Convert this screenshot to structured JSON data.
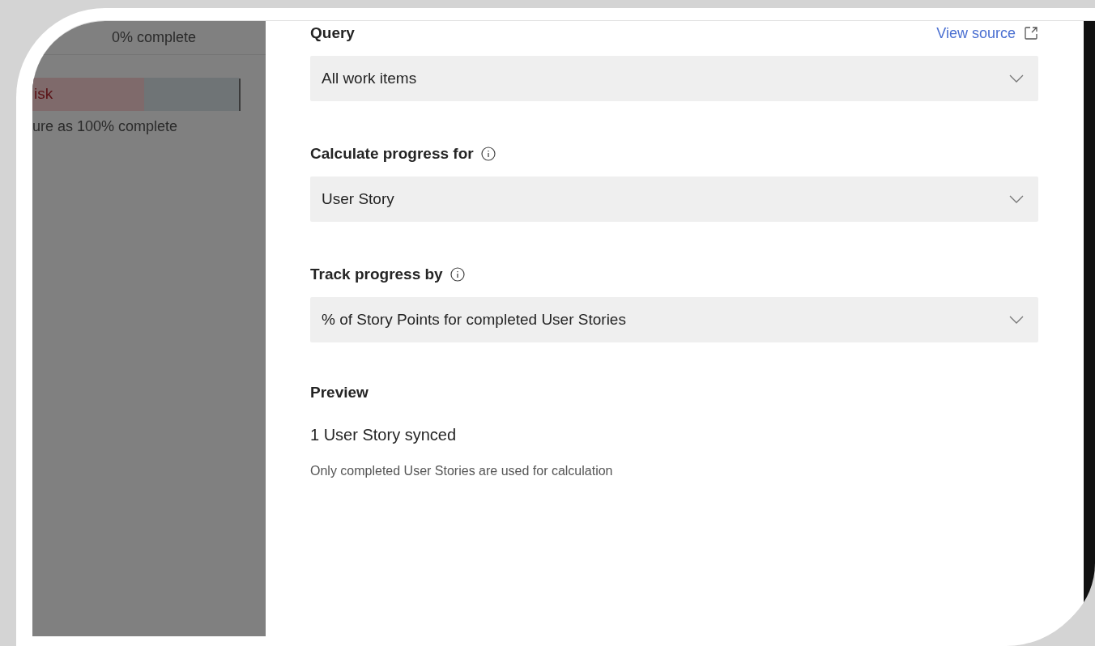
{
  "background_panel": {
    "progress_text": "0% complete",
    "status_bar": {
      "label": "isk",
      "level": 0.54
    },
    "note": "ure as 100% complete"
  },
  "fields": [
    {
      "label": "Query",
      "info": false,
      "link": "View source",
      "value": "All work items"
    },
    {
      "label": "Calculate progress for",
      "info": true,
      "value": "User Story"
    },
    {
      "label": "Track progress by",
      "info": true,
      "value": "% of Story Points for completed User Stories"
    }
  ],
  "preview": {
    "title": "Preview",
    "summary": "1 User Story synced",
    "note": "Only completed User Stories are used for calculation"
  }
}
